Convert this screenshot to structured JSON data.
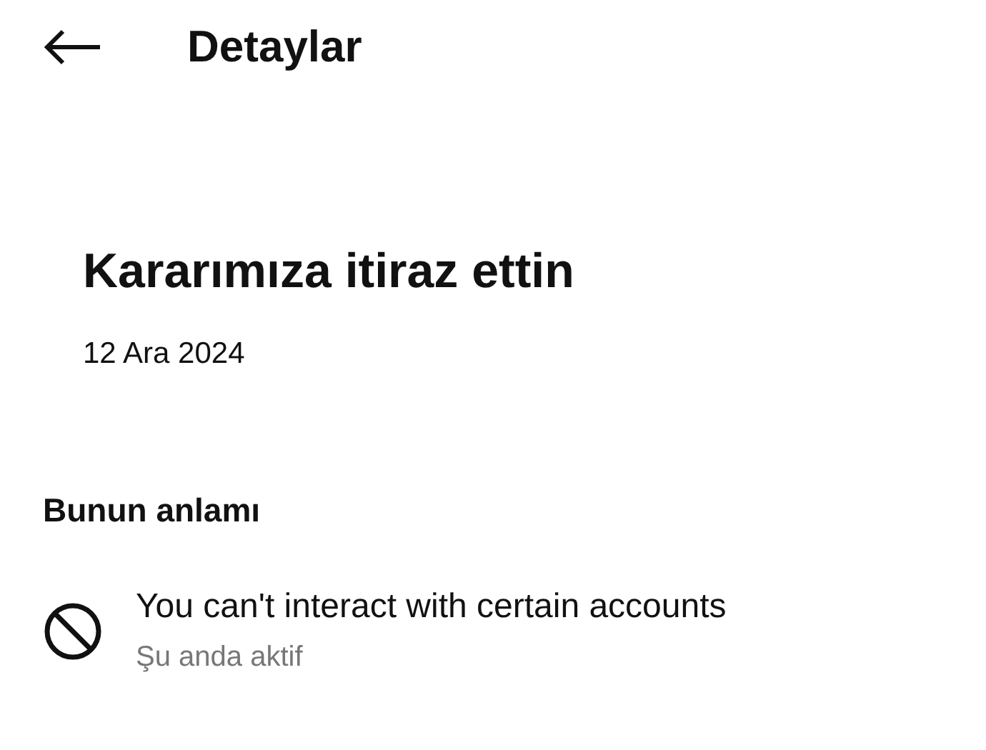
{
  "header": {
    "title": "Detaylar"
  },
  "decision": {
    "title": "Kararımıza itiraz ettin",
    "date": "12 Ara 2024"
  },
  "meaning": {
    "title": "Bunun anlamı",
    "items": [
      {
        "kind": "restriction",
        "text": "You can't interact with certain accounts",
        "status": "Şu anda aktif"
      }
    ]
  }
}
